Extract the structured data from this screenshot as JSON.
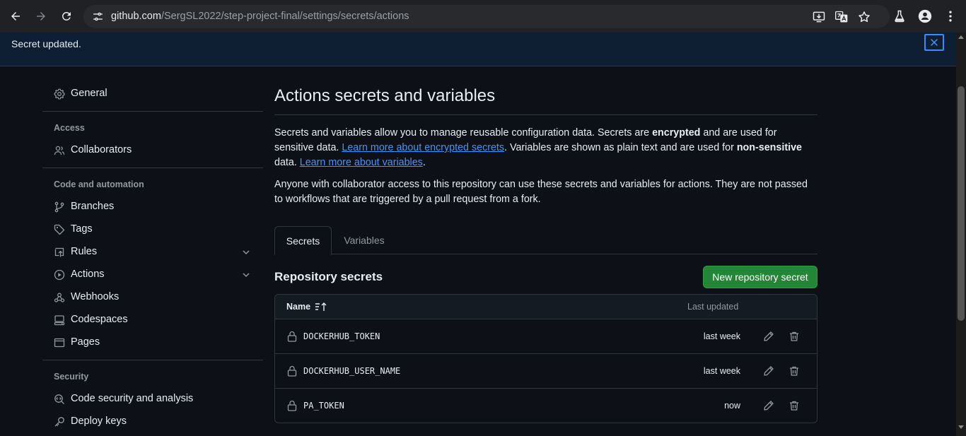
{
  "browser": {
    "url_host": "github.com",
    "url_path": "/SergSL2022/step-project-final/settings/secrets/actions"
  },
  "flash": {
    "message": "Secret updated."
  },
  "sidebar": {
    "general": "General",
    "access_heading": "Access",
    "collaborators": "Collaborators",
    "code_heading": "Code and automation",
    "branches": "Branches",
    "tags": "Tags",
    "rules": "Rules",
    "actions": "Actions",
    "webhooks": "Webhooks",
    "codespaces": "Codespaces",
    "pages": "Pages",
    "security_heading": "Security",
    "code_security": "Code security and analysis",
    "deploy_keys": "Deploy keys"
  },
  "main": {
    "title": "Actions secrets and variables",
    "p1_a": "Secrets and variables allow you to manage reusable configuration data. Secrets are ",
    "p1_b": "encrypted",
    "p1_c": " and are used for sensitive data. ",
    "p1_link1": "Learn more about encrypted secrets",
    "p1_d": ". Variables are shown as plain text and are used for ",
    "p1_e": "non-sensitive",
    "p1_f": " data. ",
    "p1_link2": "Learn more about variables",
    "p1_g": ".",
    "p2": "Anyone with collaborator access to this repository can use these secrets and variables for actions. They are not passed to workflows that are triggered by a pull request from a fork.",
    "tabs": [
      "Secrets",
      "Variables"
    ],
    "section_title": "Repository secrets",
    "new_button": "New repository secret",
    "table": {
      "col_name": "Name",
      "col_updated": "Last updated",
      "rows": [
        {
          "name": "DOCKERHUB_TOKEN",
          "updated": "last week"
        },
        {
          "name": "DOCKERHUB_USER_NAME",
          "updated": "last week"
        },
        {
          "name": "PA_TOKEN",
          "updated": "now"
        }
      ]
    }
  },
  "colors": {
    "background": "#0d1117",
    "accent_link": "#4493f8",
    "primary_button": "#238636",
    "flash_bg": "#0f1f33"
  }
}
